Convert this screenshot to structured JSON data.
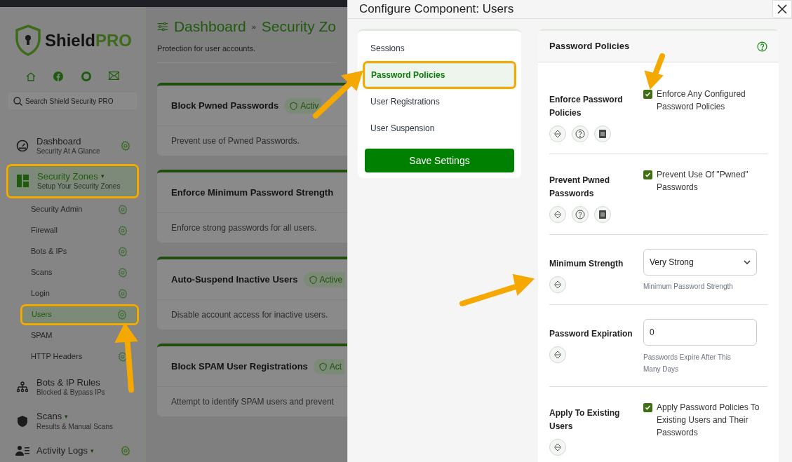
{
  "brand": {
    "name": "Shield",
    "suffix": "PRO"
  },
  "sidebar": {
    "search": {
      "placeholder": "Search Shield Security PRO"
    },
    "items": [
      {
        "label": "Dashboard",
        "subtitle": "Security At A Glance",
        "gear": true,
        "highlighted": false,
        "selected": false
      },
      {
        "label": "Security Zones",
        "caret": "▾",
        "subtitle": "Setup Your Security Zones",
        "gear": false,
        "highlighted": true,
        "selected": true,
        "children": [
          {
            "label": "Security Admin",
            "gear": true,
            "selected": false,
            "highlighted": false
          },
          {
            "label": "Firewall",
            "gear": true,
            "selected": false,
            "highlighted": false
          },
          {
            "label": "Bots & IPs",
            "gear": true,
            "selected": false,
            "highlighted": false
          },
          {
            "label": "Scans",
            "gear": true,
            "selected": false,
            "highlighted": false
          },
          {
            "label": "Login",
            "gear": true,
            "selected": false,
            "highlighted": false
          },
          {
            "label": "Users",
            "gear": true,
            "selected": true,
            "highlighted": true
          },
          {
            "label": "SPAM",
            "gear": false,
            "selected": false,
            "highlighted": false
          },
          {
            "label": "HTTP Headers",
            "gear": true,
            "selected": false,
            "highlighted": false
          }
        ]
      },
      {
        "label": "Bots & IP Rules",
        "subtitle": "Blocked & Bypass IPs",
        "gear": false,
        "highlighted": false,
        "selected": false
      },
      {
        "label": "Scans",
        "caret": "▾",
        "subtitle": "Results & Manual Scans",
        "gear": false,
        "highlighted": false,
        "selected": false
      },
      {
        "label": "Activity Logs",
        "caret": "▾",
        "gear": true,
        "highlighted": false,
        "selected": false
      }
    ]
  },
  "main": {
    "breadcrumb": [
      {
        "label": "Dashboard"
      },
      {
        "label": "Security Zo"
      }
    ],
    "separator": "»",
    "subtitle": "Protection for user accounts.",
    "cards": [
      {
        "title": "Block Pwned Passwords",
        "badge": "Activ",
        "description": "Prevent use of Pwned Passwords."
      },
      {
        "title": "Enforce Minimum Password Strength",
        "description": "Enforce strong passwords for all users."
      },
      {
        "title": "Auto-Suspend Inactive Users",
        "badge": "Active",
        "description": "Disable account access for inactive users."
      },
      {
        "title": "Block SPAM User Registrations",
        "badge": "Act",
        "description": "Attempt to identify SPAM users and prevent"
      }
    ]
  },
  "modal": {
    "title": "Configure Component: Users",
    "nav": [
      {
        "label": "Sessions",
        "selected": false,
        "highlighted": false
      },
      {
        "label": "Password Policies",
        "selected": true,
        "highlighted": true
      },
      {
        "label": "User Registrations",
        "selected": false,
        "highlighted": false
      },
      {
        "label": "User Suspension",
        "selected": false,
        "highlighted": false
      }
    ],
    "save_button": "Save Settings",
    "panel": {
      "title": "Password Policies",
      "rows": [
        {
          "label": "Enforce Password Policies",
          "kind": "checkbox",
          "checked": true,
          "option": "Enforce Any Configured Password Policies",
          "help": true,
          "docs": true
        },
        {
          "label": "Prevent Pwned Passwords",
          "kind": "checkbox",
          "checked": true,
          "option": "Prevent Use Of \"Pwned\" Passwords",
          "help": true,
          "docs": true
        },
        {
          "label": "Minimum Strength",
          "kind": "select",
          "value": "Very Strong",
          "hint": "Minimum Password Strength",
          "help": false,
          "docs": false
        },
        {
          "label": "Password Expiration",
          "kind": "number",
          "value": "0",
          "hint": "Passwords Expire After This Many Days",
          "help": false,
          "docs": false
        },
        {
          "label": "Apply To Existing Users",
          "kind": "checkbox",
          "checked": true,
          "option": "Apply Password Policies To Existing Users and Their Passwords",
          "help": false,
          "docs": false
        }
      ]
    }
  }
}
